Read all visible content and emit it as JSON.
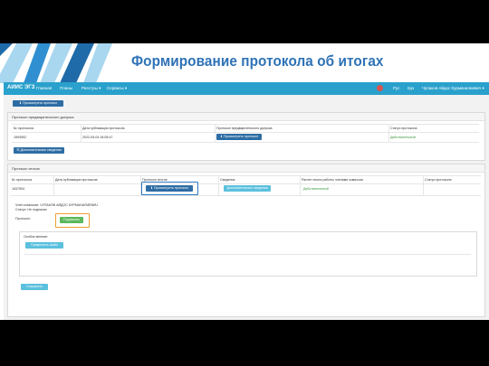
{
  "slide": {
    "title": "Формирование протокола об итогах",
    "colors": {
      "title": "#2e72b6",
      "deco_dark": "#1f6aa8",
      "deco_mid": "#2f8fd0",
      "deco_light": "#a8d7ef",
      "highlight_blue": "#2b78c2",
      "highlight_orange": "#f0a030"
    }
  },
  "navbar": {
    "brand": "АИИС ЭГЗ",
    "items": [
      "Главная",
      "Планы",
      "Реестры ▾",
      "Сервисы ▾"
    ],
    "lang_ru": "Рус",
    "lang_kz": "Қаз",
    "user": "Чупаков Айдос Курманалиевич ▾",
    "color": "#2aa1cc"
  },
  "top_button": "Просмотреть протокол",
  "prelim": {
    "header": "Протокол предварительного допуска",
    "columns": [
      "№ протокола",
      "Дата публикации протокола",
      "Протокол предварительного допуска",
      "Статус протокола"
    ],
    "row": {
      "number": "1593502",
      "date": "2022-05-04 16:05:47",
      "action": "Просмотреть протокол",
      "status": "Действительный"
    },
    "extra_button": "Дополнительные сведения"
  },
  "results": {
    "header": "Протокол итогов",
    "columns": [
      "№ протокола",
      "Дата публикации протокола",
      "Протокол итогов",
      "Сведения",
      "Расчет опыта работы членами комиссии",
      "Статус протокола"
    ],
    "row": {
      "number": "1637504",
      "date": "",
      "action": "Просмотреть протокол",
      "details": "Дополнительные сведения",
      "status": "Действительный"
    }
  },
  "sign": {
    "member": "Член комиссии: ЧУПАКОВ АЙДОС КУРМАНАЛИЕВИЧ",
    "status": "Статус: Не подписан",
    "protocol_label": "Протокол:",
    "sign_button": "Подписать",
    "opinion_label": "Особое мнение:",
    "attach_button": "Прикрепить файл",
    "save_button": "Сохранить"
  }
}
